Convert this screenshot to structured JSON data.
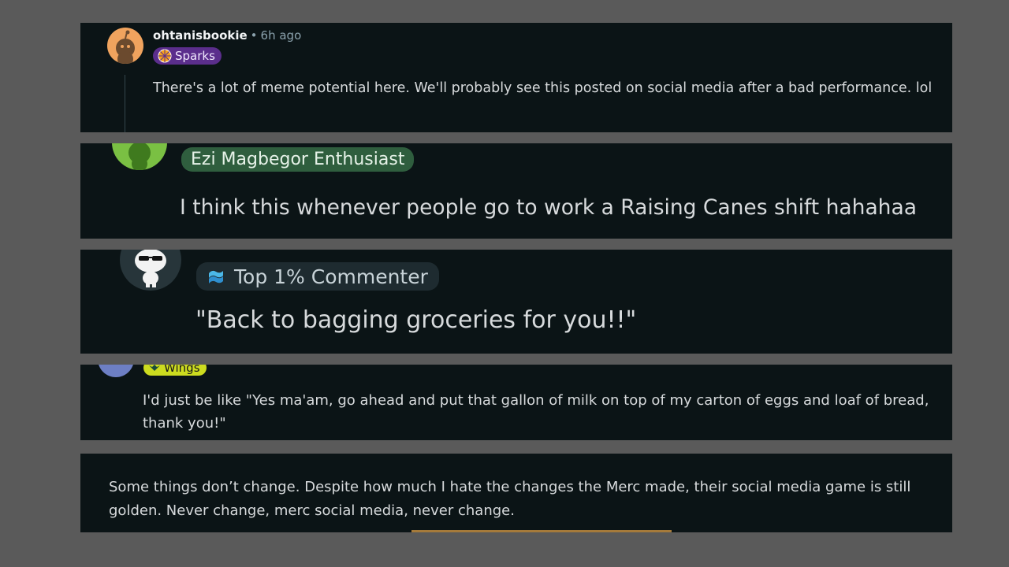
{
  "comments": [
    {
      "username": "ohtanisbookie",
      "time": "6h ago",
      "flair": "Sparks",
      "text": "There's a lot of meme potential here. We'll probably see this posted on social media after a bad performance. lol"
    },
    {
      "flair": "Ezi Magbegor Enthusiast",
      "text": "I think this whenever people go to work a Raising Canes shift hahahaa"
    },
    {
      "flair": "Top 1% Commenter",
      "text": "\"Back to bagging groceries for you!!\""
    },
    {
      "flair": "Wings",
      "text": "I'd just be like \"Yes ma'am, go ahead and put that gallon of milk on top of my carton of eggs and loaf of bread, thank you!\""
    },
    {
      "text": "Some things don’t change. Despite how much I hate the changes the Merc made, their social media game is still golden. Never change, merc social media, never change."
    }
  ],
  "colors": {
    "background": "#5a5a5a",
    "panel": "#0b1416",
    "sparks_flair": "#5b2e8c",
    "enthusiast_flair": "#2f5e3e",
    "top_commenter_flair": "#1e2b30",
    "wings_flair": "#cddc1f"
  }
}
